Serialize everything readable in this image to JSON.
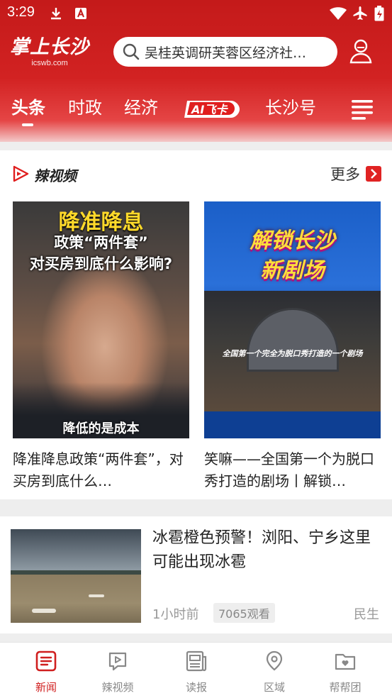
{
  "status_bar": {
    "time": "3:29",
    "icons": [
      "download-icon",
      "notification-a-icon",
      "wifi-icon",
      "airplane-icon",
      "battery-icon"
    ]
  },
  "header": {
    "logo_text": "掌上长沙",
    "logo_sub": "icswb.com",
    "search_placeholder": "吴桂英调研芙蓉区经济社…",
    "accent_color": "#d22222"
  },
  "tabs": [
    {
      "label": "头条",
      "active": true
    },
    {
      "label": "时政",
      "active": false
    },
    {
      "label": "经济",
      "active": false
    },
    {
      "label": "AI飞卡",
      "active": false
    },
    {
      "label": "长沙号",
      "active": false
    }
  ],
  "video_section": {
    "title": "辣视频",
    "more_label": "更多",
    "videos": [
      {
        "thumb_title": "降准降息",
        "thumb_line1": "政策“两件套”",
        "thumb_line2": "对买房到底什么影响?",
        "thumb_subtitle": "降低的是成本",
        "caption": "降准降息政策“两件套”，对买房到底什么…"
      },
      {
        "thumb_title": "解锁长沙",
        "thumb_title2": "新剧场",
        "thumb_line1": "全国第一个完全为脱口秀打造的一个剧场",
        "caption": "笑嘛——全国第一个为脱口秀打造的剧场丨解锁…"
      }
    ]
  },
  "news": [
    {
      "title": "冰雹橙色预警！浏阳、宁乡这里可能出现冰雹",
      "time": "1小时前",
      "views": "7065观看",
      "category": "民生"
    }
  ],
  "bottom_nav": [
    {
      "label": "新闻",
      "icon": "news-icon",
      "active": true
    },
    {
      "label": "辣视频",
      "icon": "video-icon",
      "active": false
    },
    {
      "label": "读报",
      "icon": "newspaper-icon",
      "active": false
    },
    {
      "label": "区域",
      "icon": "location-icon",
      "active": false
    },
    {
      "label": "帮帮团",
      "icon": "folder-heart-icon",
      "active": false
    }
  ]
}
